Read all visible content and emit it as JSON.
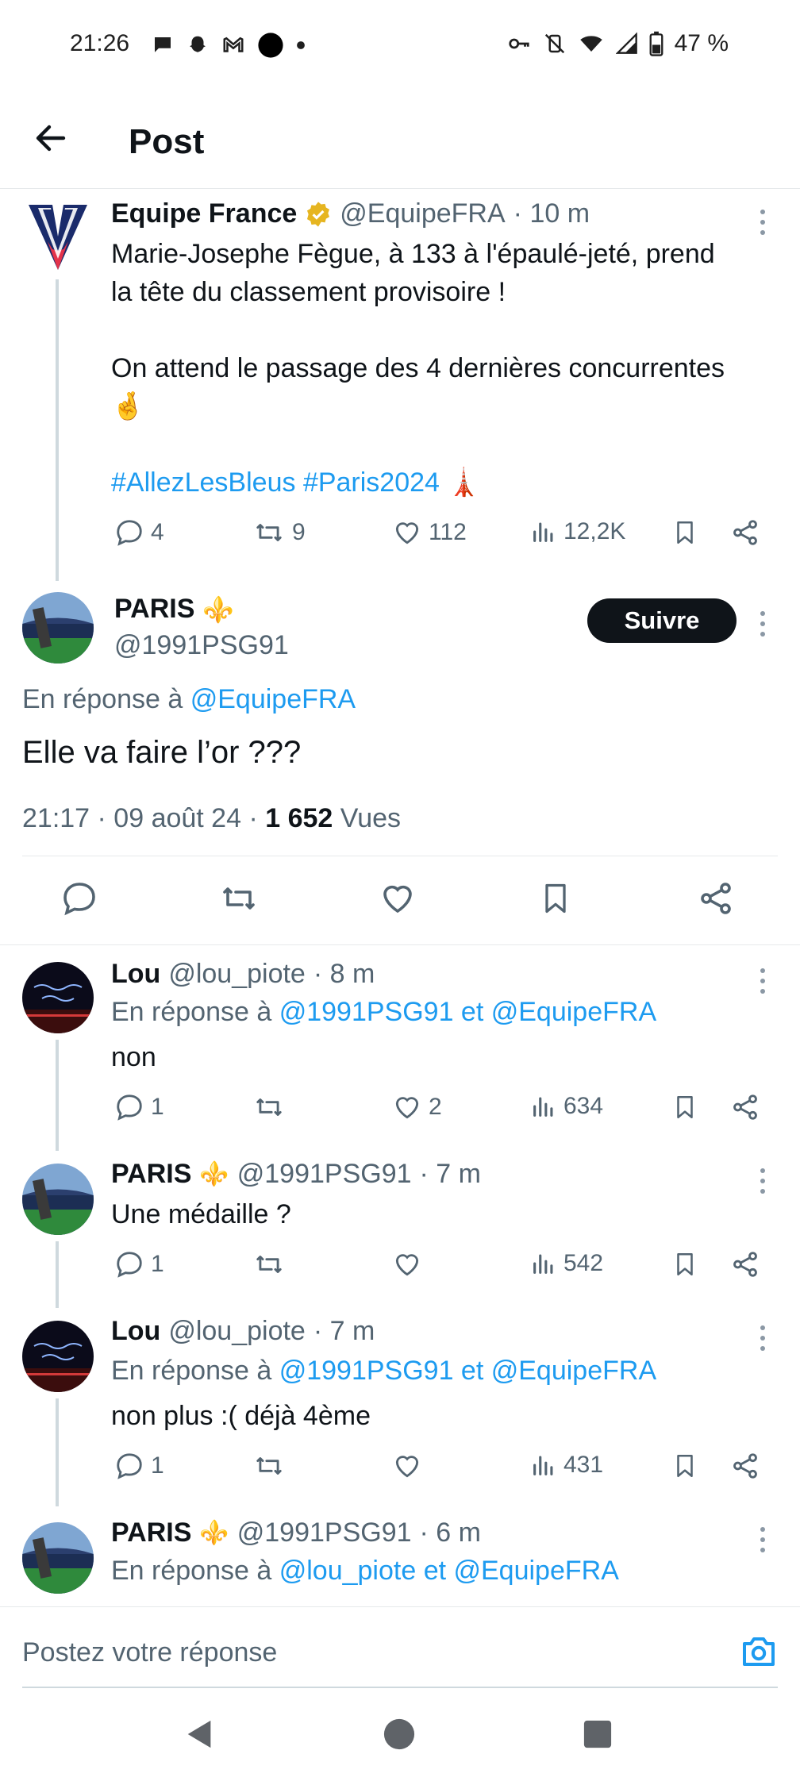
{
  "status_bar": {
    "time": "21:26",
    "battery": "47 %"
  },
  "header": {
    "title": "Post"
  },
  "colors": {
    "accent": "#1d9bf0",
    "text": "#0f1419",
    "muted": "#536471",
    "gold_verified": "#e6b520"
  },
  "parent_tweet": {
    "name": "Equipe France",
    "handle": "@EquipeFRA",
    "time": "· 10 m",
    "line1": "Marie-Josephe Fègue, à 133 à l'épaulé-jeté, prend",
    "line2": "la tête du classement provisoire !",
    "line3": "On attend le passage des 4 dernières concurrentes",
    "emoji": "🤞",
    "hashtag1": "#AllezLesBleus",
    "hashtag2": "#Paris2024",
    "tower": "🗼",
    "replies": "4",
    "retweets": "9",
    "likes": "112",
    "views": "12,2K"
  },
  "main_tweet": {
    "name": "PARIS",
    "name_emoji": "⚜️",
    "handle": "@1991PSG91",
    "follow_label": "Suivre",
    "reply_prefix": "En réponse à",
    "reply_to": "@EquipeFRA",
    "text": "Elle va faire l’or ???",
    "timestamp": "21:17 · 09 août 24 ·",
    "views_count": "1 652",
    "views_label": "Vues"
  },
  "replies": [
    {
      "name": "Lou",
      "handle": "@lou_piote",
      "time": "· 8 m",
      "reply_prefix": "En réponse à",
      "reply_to": "@1991PSG91 et @EquipeFRA",
      "text": "non",
      "replies": "1",
      "retweets": "",
      "likes": "2",
      "views": "634"
    },
    {
      "name": "PARIS",
      "name_emoji": "⚜️",
      "handle": "@1991PSG91",
      "time": "· 7 m",
      "text": "Une médaille ?",
      "replies": "1",
      "retweets": "",
      "likes": "",
      "views": "542"
    },
    {
      "name": "Lou",
      "handle": "@lou_piote",
      "time": "· 7 m",
      "reply_prefix": "En réponse à",
      "reply_to": "@1991PSG91 et @EquipeFRA",
      "text": "non plus :( déjà 4ème",
      "replies": "1",
      "retweets": "",
      "likes": "",
      "views": "431"
    },
    {
      "name": "PARIS",
      "name_emoji": "⚜️",
      "handle": "@1991PSG91",
      "time": "· 6 m",
      "reply_prefix": "En réponse à",
      "reply_to": "@lou_piote et @EquipeFRA"
    }
  ],
  "composer": {
    "placeholder": "Postez votre réponse"
  }
}
